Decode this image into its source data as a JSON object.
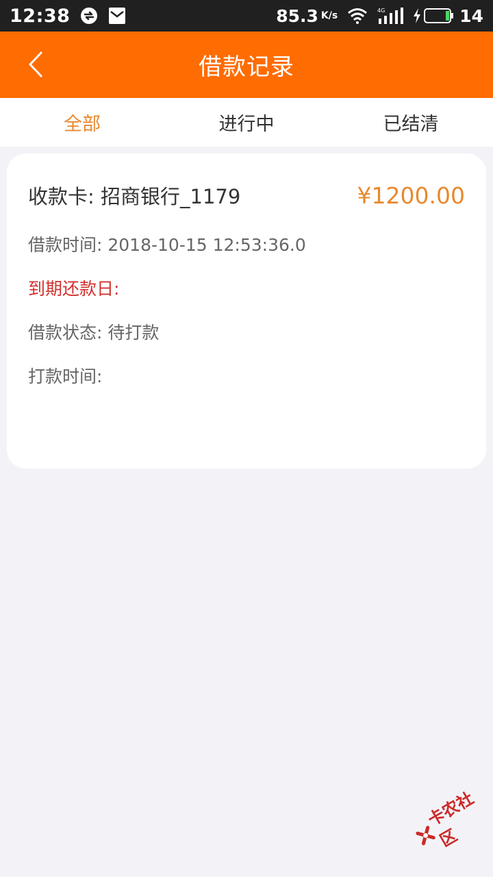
{
  "status_bar": {
    "time": "12:38",
    "speed": "85.3",
    "speed_unit": "K/s",
    "network": "4G",
    "battery": "14"
  },
  "header": {
    "title": "借款记录",
    "back_icon": "chevron-left-icon",
    "background": "#ff6c02"
  },
  "tabs": [
    {
      "label": "全部",
      "active": true
    },
    {
      "label": "进行中",
      "active": false
    },
    {
      "label": "已结清",
      "active": false
    }
  ],
  "record": {
    "bank": "收款卡: 招商银行_1179",
    "amount": "¥1200.00",
    "loan_time": "借款时间: 2018-10-15 12:53:36.0",
    "due_date": "到期还款日:",
    "status": "借款状态: 待打款",
    "payout_time": "打款时间:"
  },
  "watermark": {
    "text": "卡农社区",
    "icon": "kanong-logo-icon"
  },
  "colors": {
    "accent": "#e8892e",
    "due_red": "#d2302e",
    "page_bg": "#f3f3f7"
  }
}
